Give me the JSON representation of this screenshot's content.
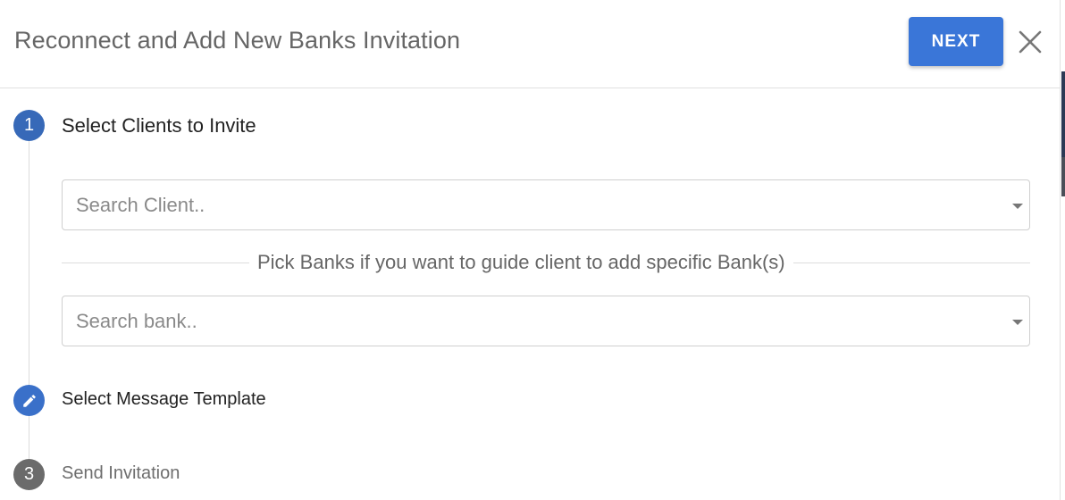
{
  "dialog": {
    "title": "Reconnect and Add New Banks Invitation",
    "next_label": "NEXT",
    "close_icon": "close-icon"
  },
  "steps": [
    {
      "number": "1",
      "label": "Select Clients to Invite",
      "state": "active"
    },
    {
      "number": "",
      "label": "Select Message Template",
      "state": "edit",
      "icon": "pencil-icon"
    },
    {
      "number": "3",
      "label": "Send Invitation",
      "state": "inactive"
    }
  ],
  "client_select": {
    "placeholder": "Search Client..",
    "value": ""
  },
  "divider_text": "Pick Banks if you want to guide client to add specific Bank(s)",
  "bank_select": {
    "placeholder": "Search bank..",
    "value": ""
  },
  "colors": {
    "primary": "#3a76d8",
    "step_active": "#3769b8",
    "step_inactive": "#6b6b6b"
  }
}
